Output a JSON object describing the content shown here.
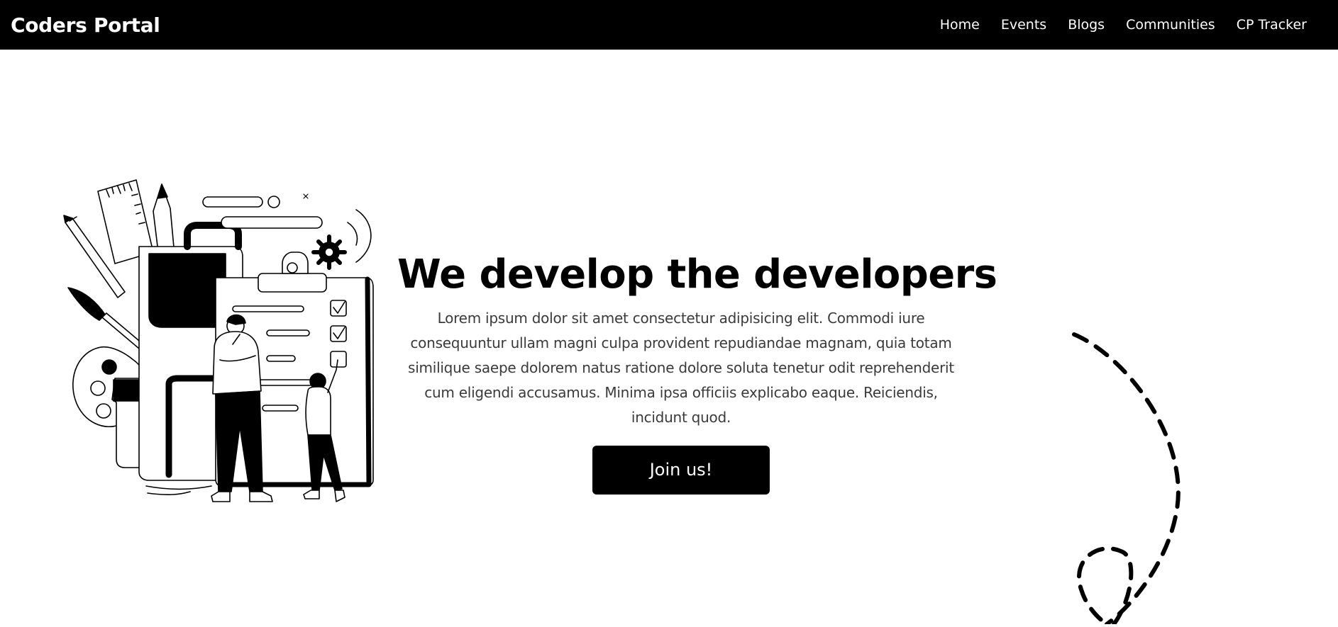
{
  "navbar": {
    "brand": "Coders Portal",
    "links": [
      {
        "label": "Home"
      },
      {
        "label": "Events"
      },
      {
        "label": "Blogs"
      },
      {
        "label": "Communities"
      },
      {
        "label": "CP Tracker"
      }
    ]
  },
  "hero": {
    "title": "We develop the developers",
    "description": "Lorem ipsum dolor sit amet consectetur adipisicing elit. Commodi iure consequuntur ullam magni culpa provident repudiandae magnam, quia totam similique saepe dolorem natus ratione dolore soluta tenetur odit reprehenderit cum eligendi accusamus. Minima ipsa officiis explicabo eaque. Reiciendis, incidunt quod.",
    "cta_label": "Join us!"
  },
  "colors": {
    "navbar_background": "#000000",
    "navbar_text": "#ffffff",
    "button_background": "#000000",
    "button_text": "#ffffff",
    "body_text": "#3a3a3a",
    "page_background": "#ffffff"
  },
  "illustration": {
    "icon": "developers-at-work-illustration"
  },
  "decoration": {
    "icon": "dashed-loop-path-icon"
  }
}
